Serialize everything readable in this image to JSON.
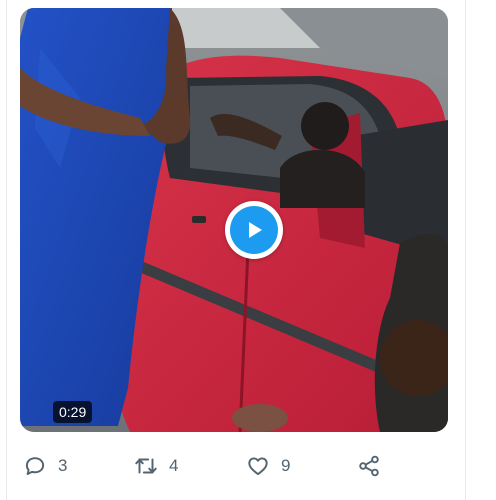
{
  "video": {
    "duration": "0:29",
    "play_icon": "play-icon"
  },
  "actions": {
    "replies": "3",
    "retweets": "4",
    "likes": "9",
    "reply_icon": "speech-bubble-icon",
    "retweet_icon": "retweet-icon",
    "like_icon": "heart-icon",
    "share_icon": "share-nodes-icon"
  },
  "colors": {
    "accent": "#1d9bf0",
    "icon_gray": "#536471"
  }
}
